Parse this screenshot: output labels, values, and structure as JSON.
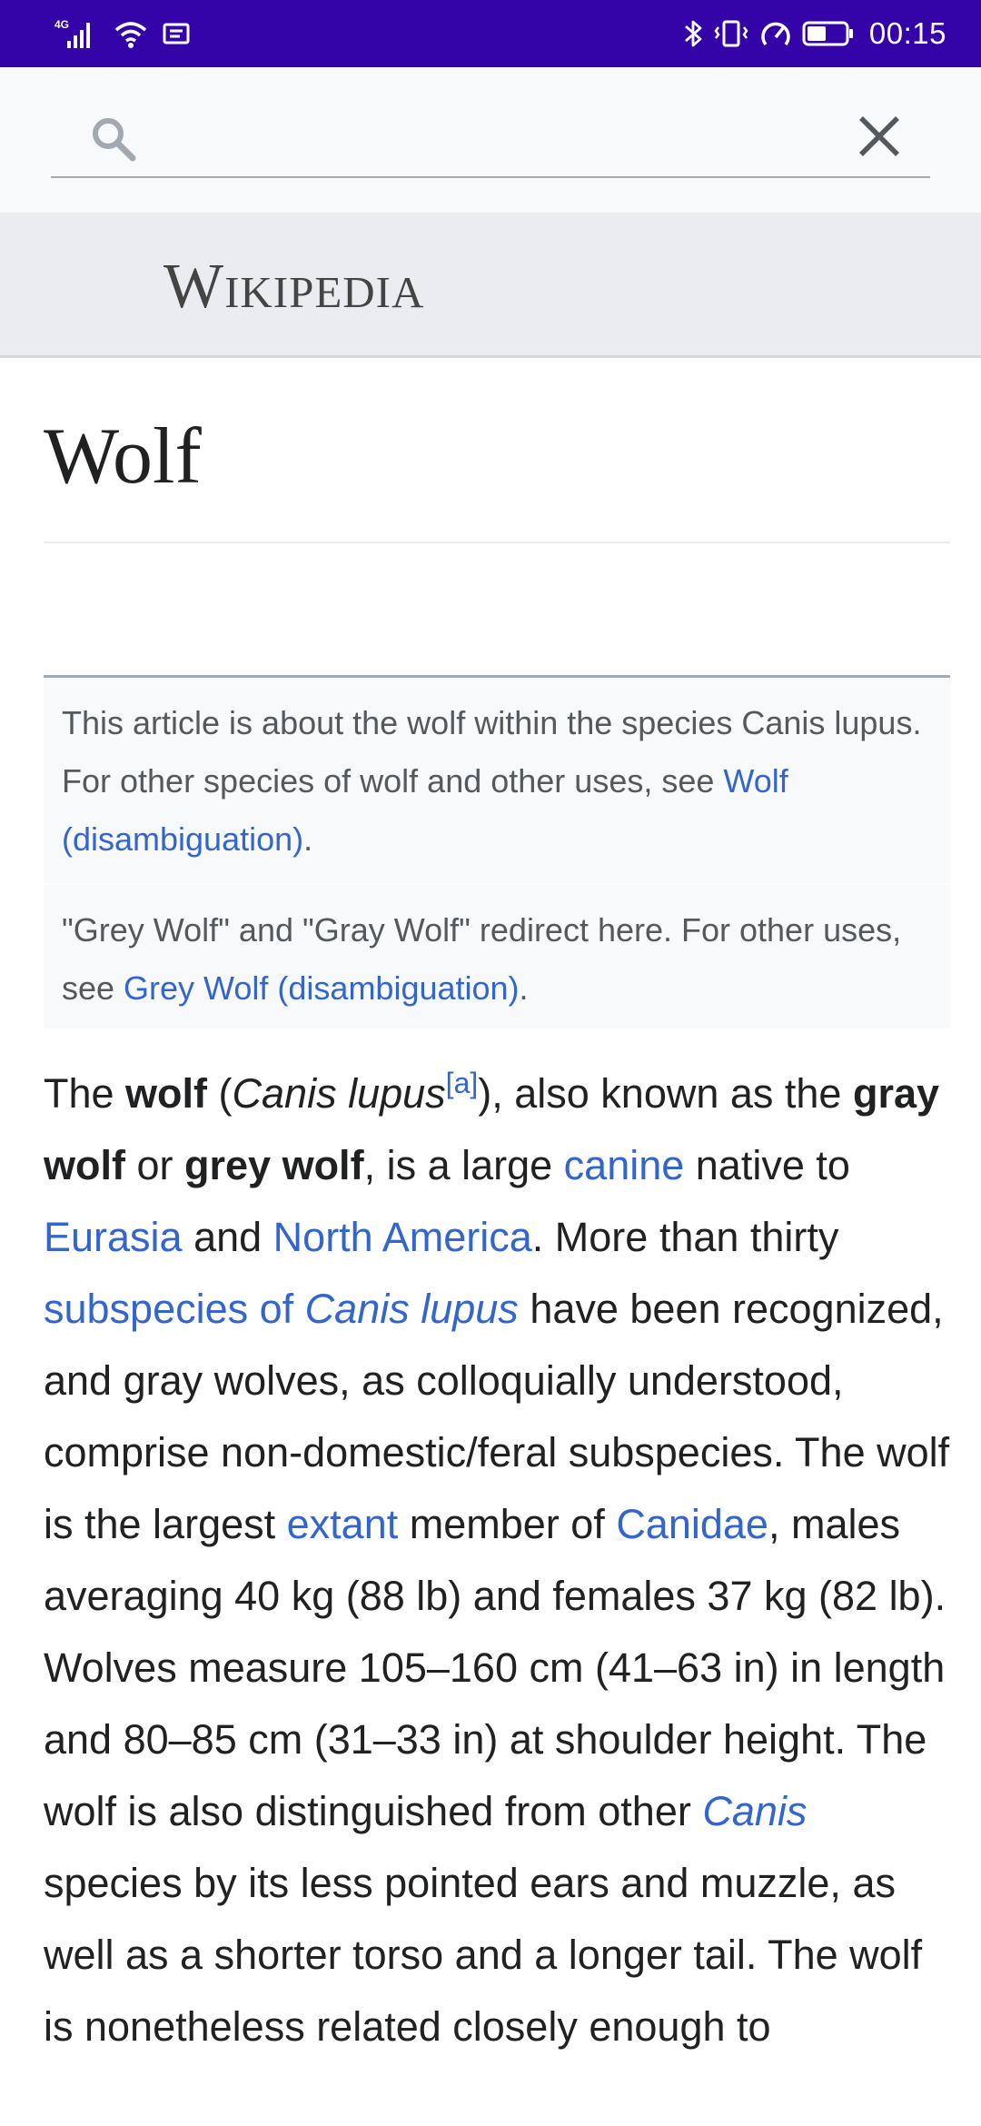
{
  "status_bar": {
    "network": "4G",
    "time": "00:15"
  },
  "search": {
    "placeholder": "",
    "value": ""
  },
  "banner": {
    "wordmark": "Wikipedia"
  },
  "article": {
    "title": "Wolf",
    "hatnote1": {
      "text": "This article is about the wolf within the species Canis lupus. For other species of wolf and other uses, see ",
      "link": "Wolf (disambiguation)",
      "end": "."
    },
    "hatnote2": {
      "text": "\"Grey Wolf\" and \"Gray Wolf\" redirect here. For other uses, see ",
      "link": "Grey Wolf (disambiguation)",
      "end": "."
    },
    "lead": {
      "t1": "The ",
      "b1": "wolf",
      "t2": " (",
      "i1": "Canis lupus",
      "ref": "[a]",
      "t3": "), also known as the ",
      "b2": "gray wolf",
      "t4": " or ",
      "b3": "grey wolf",
      "t5": ", is a large ",
      "l_canine": "canine",
      "t6": " native to ",
      "l_eurasia": "Eurasia",
      "t7": " and ",
      "l_na": "North America",
      "t8": ". More than thirty ",
      "l_sub_a": "subspecies of ",
      "l_sub_b": "Canis lupus",
      "t9": " have been recognized, and gray wolves, as colloquially understood, comprise non-domestic/feral subspecies. The wolf is the largest ",
      "l_extant": "extant",
      "t10": " member of ",
      "l_canidae": "Canidae",
      "t11": ", males averaging 40 kg (88 lb) and females 37 kg (82 lb). Wolves measure 105–160 cm (41–63 in) in length and 80–85 cm (31–33 in) at shoulder height. The wolf is also distinguished from other ",
      "l_canis": "Canis",
      "t12": " species by its less pointed ears and muzzle, as well as a shorter torso and a longer tail. The wolf is nonetheless related closely enough to"
    }
  },
  "colors": {
    "status_bar": "#3504a8",
    "link": "#3366cc",
    "banner_bg": "#eaecf0",
    "hatnote_bg": "#f8f9fa"
  },
  "icons": [
    "signal-icon",
    "wifi-icon",
    "message-icon",
    "bluetooth-icon",
    "vibrate-icon",
    "speed-icon",
    "battery-icon",
    "search-icon",
    "close-icon"
  ]
}
